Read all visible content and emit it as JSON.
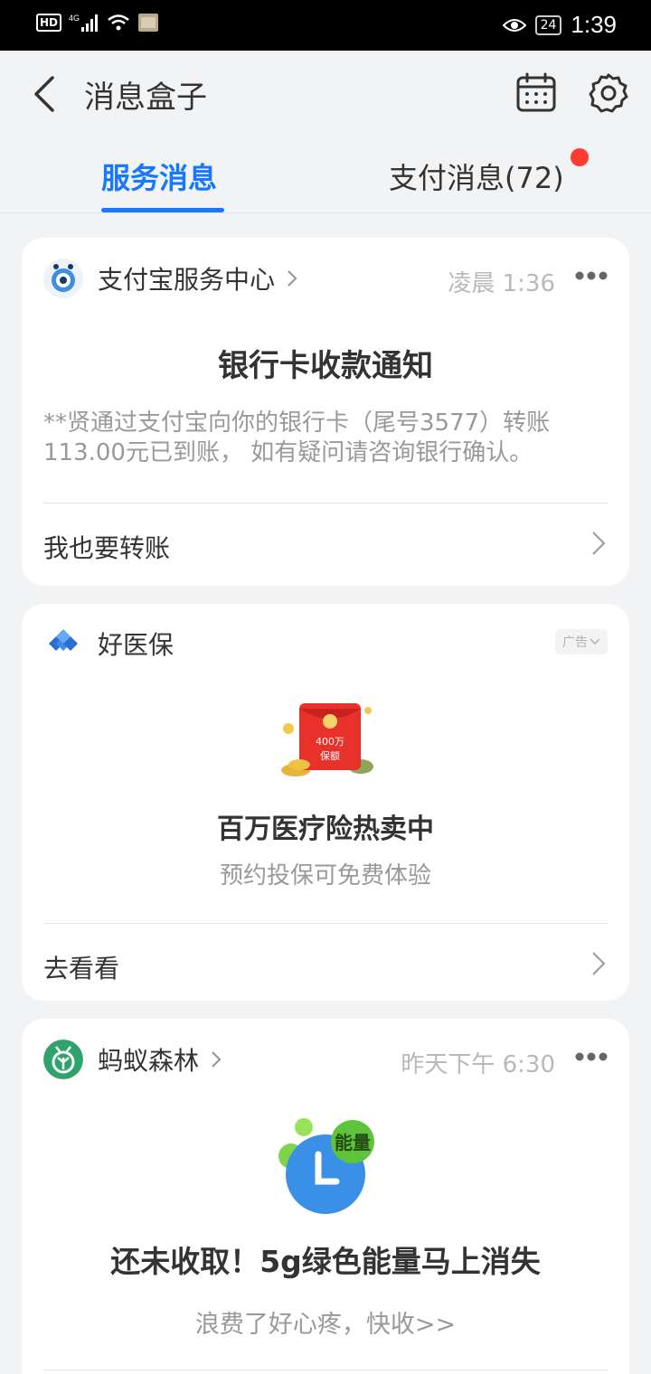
{
  "status_bar": {
    "hd": "HD",
    "network": "4G",
    "battery": "24",
    "time": "1:39"
  },
  "header": {
    "title": "消息盒子"
  },
  "tabs": [
    {
      "label": "服务消息",
      "active": true
    },
    {
      "label": "支付消息(72)",
      "active": false,
      "has_dot": true
    }
  ],
  "cards": [
    {
      "source": "支付宝服务中心",
      "time": "凌晨 1:36",
      "title": "银行卡收款通知",
      "body": "**贤通过支付宝向你的银行卡（尾号3577）转账113.00元已到账， 如有疑问请咨询银行确认。",
      "action": "我也要转账"
    },
    {
      "source": "好医保",
      "ad_label": "广告",
      "image_text_top": "400万",
      "image_text_bottom": "保额",
      "title": "百万医疗险热卖中",
      "subtitle": "预约投保可免费体验",
      "action": "去看看"
    },
    {
      "source": "蚂蚁森林",
      "time": "昨天下午 6:30",
      "image_badge": "能量",
      "title": "还未收取！5g绿色能量马上消失",
      "subtitle": "浪费了好心疼，快收>>"
    }
  ],
  "colors": {
    "accent": "#1677ff",
    "badge_dot": "#ff3b30",
    "page_bg": "#f2f3f5"
  }
}
